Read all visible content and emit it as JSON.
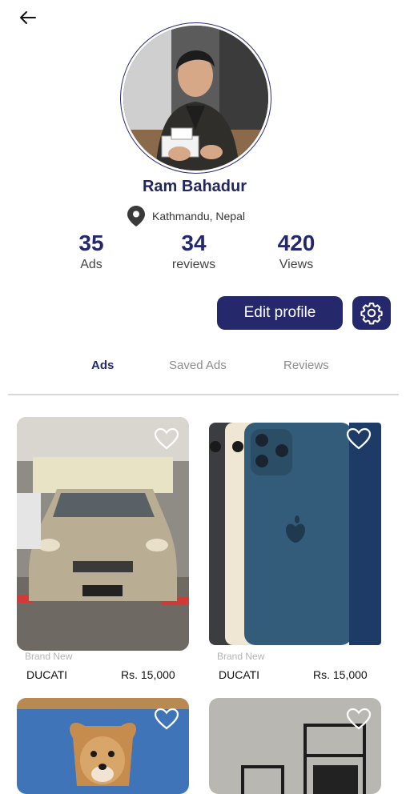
{
  "profile": {
    "name": "Ram Bahadur",
    "location": "Kathmandu, Nepal"
  },
  "stats": [
    {
      "value": "35",
      "label": "Ads"
    },
    {
      "value": "34",
      "label": "reviews"
    },
    {
      "value": "420",
      "label": "Views"
    }
  ],
  "actions": {
    "edit_label": "Edit profile"
  },
  "tabs": [
    {
      "label": "Ads",
      "active": true
    },
    {
      "label": "Saved Ads",
      "active": false
    },
    {
      "label": "Reviews",
      "active": false
    }
  ],
  "listings": [
    {
      "condition": "Brand New",
      "title": "DUCATI",
      "price": "Rs. 15,000",
      "image": "car-photo"
    },
    {
      "condition": "Brand New",
      "title": "DUCATI",
      "price": "Rs. 15,000",
      "image": "phone-photo"
    },
    {
      "condition": "",
      "title": "",
      "price": "",
      "image": "dog-photo"
    },
    {
      "condition": "",
      "title": "",
      "price": "",
      "image": "furniture-photo"
    }
  ],
  "colors": {
    "primary": "#25296b",
    "inactive_tab": "#8c8c8c",
    "divider": "#d8d8d8"
  }
}
